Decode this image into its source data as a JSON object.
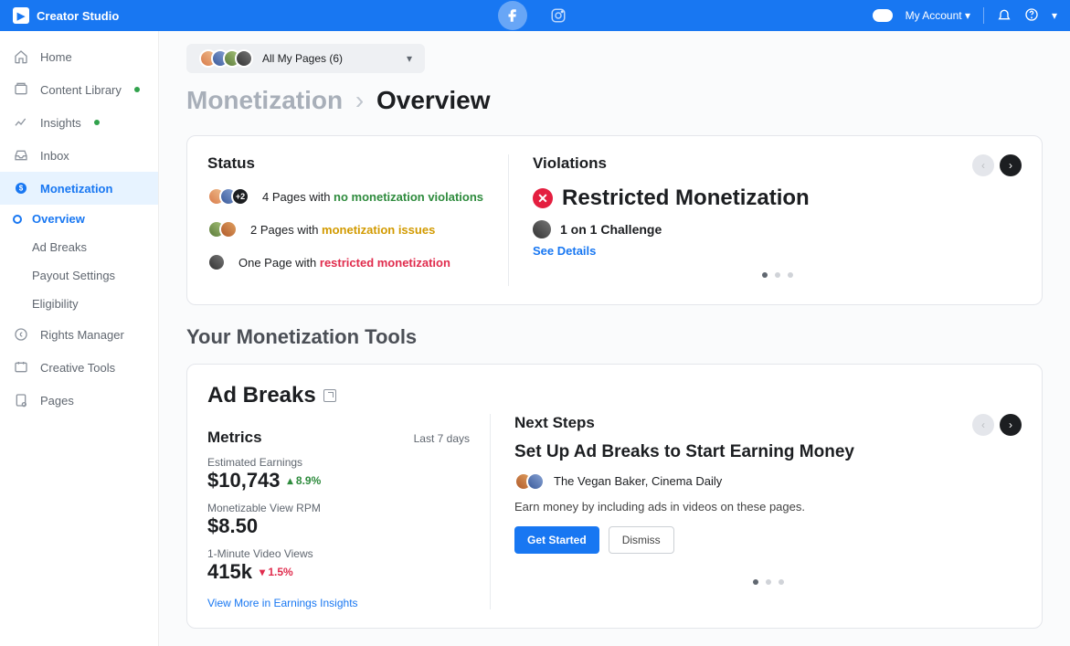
{
  "header": {
    "brand": "Creator Studio",
    "account": "My Account"
  },
  "sidebar": {
    "items": [
      {
        "label": "Home"
      },
      {
        "label": "Content Library"
      },
      {
        "label": "Insights"
      },
      {
        "label": "Inbox"
      },
      {
        "label": "Monetization"
      },
      {
        "label": "Rights Manager"
      },
      {
        "label": "Creative Tools"
      },
      {
        "label": "Pages"
      }
    ],
    "monetization_sub": [
      {
        "label": "Overview"
      },
      {
        "label": "Ad Breaks"
      },
      {
        "label": "Payout Settings"
      },
      {
        "label": "Eligibility"
      }
    ]
  },
  "pagesPill": "All My Pages (6)",
  "breadcrumb": {
    "parent": "Monetization",
    "current": "Overview"
  },
  "status": {
    "title": "Status",
    "rows": [
      {
        "count_text": "4 Pages with ",
        "status": "no monetization violations",
        "overflow": "+2"
      },
      {
        "count_text": "2 Pages with ",
        "status": "monetization issues"
      },
      {
        "count_text": "One Page with ",
        "status": "restricted monetization"
      }
    ]
  },
  "violations": {
    "title": "Violations",
    "heading": "Restricted Monetization",
    "page_name": "1 on 1 Challenge",
    "see_details": "See Details"
  },
  "tools_heading": "Your Monetization Tools",
  "adbreaks": {
    "title": "Ad Breaks",
    "metrics_title": "Metrics",
    "range": "Last 7 days",
    "m1_label": "Estimated Earnings",
    "m1_value": "$10,743",
    "m1_delta": "8.9%",
    "m2_label": "Monetizable View RPM",
    "m2_value": "$8.50",
    "m3_label": "1-Minute Video Views",
    "m3_value": "415k",
    "m3_delta": "1.5%",
    "view_more": "View More in Earnings Insights"
  },
  "next_steps": {
    "title": "Next Steps",
    "heading": "Set Up Ad Breaks to Start Earning Money",
    "pages": "The Vegan Baker, Cinema Daily",
    "desc": "Earn money by including ads in videos on these pages.",
    "primary": "Get Started",
    "secondary": "Dismiss"
  }
}
